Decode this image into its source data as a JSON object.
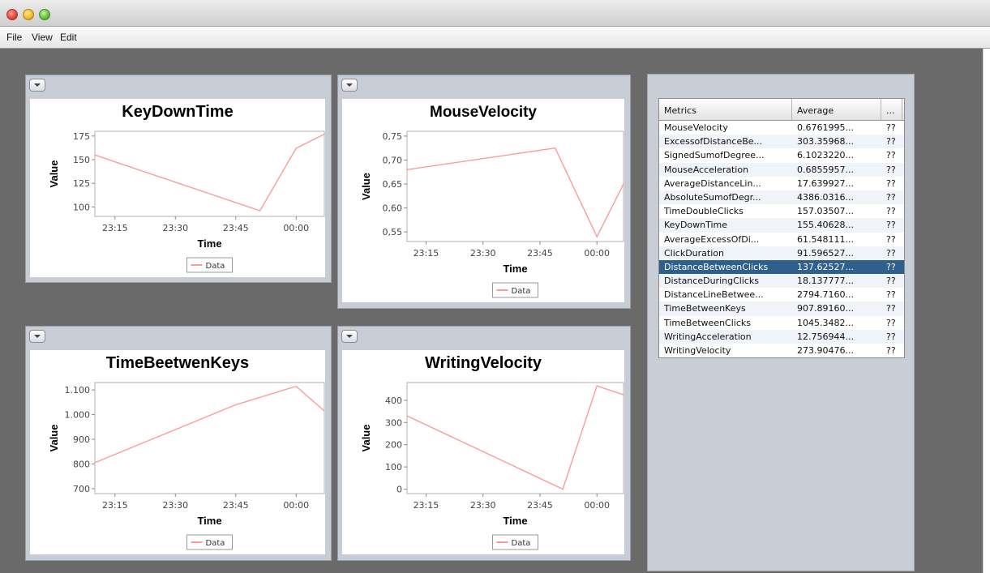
{
  "menu": [
    "File",
    "View",
    "Edit"
  ],
  "charts": [
    {
      "title": "KeyDownTime",
      "xlabel": "Time",
      "ylabel": "Value",
      "xticks": [
        "23:15",
        "23:30",
        "23:45",
        "00:00"
      ],
      "yticks": [
        "175",
        "150",
        "125",
        "100"
      ],
      "legend": "Data"
    },
    {
      "title": "MouseVelocity",
      "xlabel": "Time",
      "ylabel": "Value",
      "xticks": [
        "23:15",
        "23:30",
        "23:45",
        "00:00"
      ],
      "yticks": [
        "0,75",
        "0,70",
        "0,65",
        "0,60",
        "0,55"
      ],
      "legend": "Data"
    },
    {
      "title": "TimeBeetwenKeys",
      "xlabel": "Time",
      "ylabel": "Value",
      "xticks": [
        "23:15",
        "23:30",
        "23:45",
        "00:00"
      ],
      "yticks": [
        "1.100",
        "1.000",
        "900",
        "800",
        "700"
      ],
      "legend": "Data"
    },
    {
      "title": "WritingVelocity",
      "xlabel": "Time",
      "ylabel": "Value",
      "xticks": [
        "23:15",
        "23:30",
        "23:45",
        "00:00"
      ],
      "yticks": [
        "400",
        "300",
        "200",
        "100",
        "0"
      ],
      "legend": "Data"
    }
  ],
  "chart_data": [
    {
      "type": "line",
      "title": "KeyDownTime",
      "xlabel": "Time",
      "ylabel": "Value",
      "ylim": [
        90,
        180
      ],
      "series": [
        {
          "name": "Data",
          "x": [
            "23:10",
            "23:51",
            "00:00",
            "00:07"
          ],
          "values": [
            155,
            96,
            162,
            177
          ]
        }
      ],
      "legend": "bottom"
    },
    {
      "type": "line",
      "title": "MouseVelocity",
      "xlabel": "Time",
      "ylabel": "Value",
      "ylim": [
        0.53,
        0.76
      ],
      "series": [
        {
          "name": "Data",
          "x": [
            "23:10",
            "23:49",
            "00:00",
            "00:07"
          ],
          "values": [
            0.68,
            0.725,
            0.54,
            0.65
          ]
        }
      ],
      "legend": "bottom"
    },
    {
      "type": "line",
      "title": "TimeBeetwenKeys",
      "xlabel": "Time",
      "ylabel": "Value",
      "ylim": [
        680,
        1130
      ],
      "series": [
        {
          "name": "Data",
          "x": [
            "23:10",
            "23:45",
            "00:00",
            "00:07"
          ],
          "values": [
            805,
            1040,
            1115,
            1015
          ]
        }
      ],
      "legend": "bottom"
    },
    {
      "type": "line",
      "title": "WritingVelocity",
      "xlabel": "Time",
      "ylabel": "Value",
      "ylim": [
        -20,
        480
      ],
      "series": [
        {
          "name": "Data",
          "x": [
            "23:10",
            "23:51",
            "00:00",
            "00:07"
          ],
          "values": [
            330,
            0,
            465,
            425
          ]
        }
      ],
      "legend": "bottom"
    }
  ],
  "table": {
    "headers": [
      "Metrics",
      "Average",
      "..."
    ],
    "rows": [
      [
        "MouseVelocity",
        "0.6761995...",
        "??"
      ],
      [
        "ExcessofDistanceBe...",
        "303.35968...",
        "??"
      ],
      [
        "SignedSumofDegree...",
        "6.1023220...",
        "??"
      ],
      [
        "MouseAcceleration",
        "0.6855957...",
        "??"
      ],
      [
        "AverageDistanceLin...",
        "17.639927...",
        "??"
      ],
      [
        "AbsoluteSumofDegr...",
        "4386.0316...",
        "??"
      ],
      [
        "TimeDoubleClicks",
        "157.03507...",
        "??"
      ],
      [
        "KeyDownTime",
        "155.40628...",
        "??"
      ],
      [
        "AverageExcessOfDi...",
        "61.548111...",
        "??"
      ],
      [
        "ClickDuration",
        "91.596527...",
        "??"
      ],
      [
        "DistanceBetweenClicks",
        "137.62527...",
        "??"
      ],
      [
        "DistanceDuringClicks",
        "18.137777...",
        "??"
      ],
      [
        "DistanceLineBetwee...",
        "2794.7160...",
        "??"
      ],
      [
        "TimeBetweenKeys",
        "907.89160...",
        "??"
      ],
      [
        "TimeBetweenClicks",
        "1045.3482...",
        "??"
      ],
      [
        "WritingAcceleration",
        "12.756944...",
        "??"
      ],
      [
        "WritingVelocity",
        "273.90476...",
        "??"
      ]
    ],
    "selected_row": 10
  },
  "colors": {
    "series": "#ff9a9a",
    "selection": "#2f5f8c"
  }
}
